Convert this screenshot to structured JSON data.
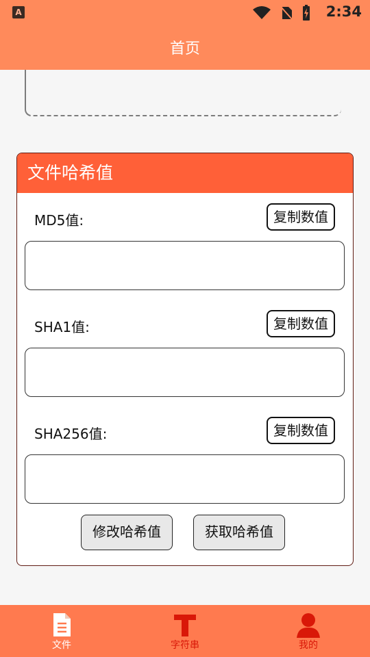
{
  "statusbar": {
    "app_icon_letter": "A",
    "time": "2:34",
    "icons": [
      "wifi-icon",
      "no-sim-icon",
      "battery-charging-icon"
    ]
  },
  "header": {
    "title": "首页"
  },
  "card": {
    "title": "文件哈希值",
    "md5": {
      "label": "MD5值:",
      "copy_label": "复制数值",
      "value": ""
    },
    "sha1": {
      "label": "SHA1值:",
      "copy_label": "复制数值",
      "value": ""
    },
    "sha256": {
      "label": "SHA256值:",
      "copy_label": "复制数值",
      "value": ""
    },
    "modify_label": "修改哈希值",
    "get_label": "获取哈希值"
  },
  "bottom_nav": {
    "items": [
      {
        "label": "文件",
        "icon": "file-icon",
        "color": "#ffffff"
      },
      {
        "label": "字符串",
        "icon": "text-t-icon",
        "color": "#d91808"
      },
      {
        "label": "我的",
        "icon": "user-icon",
        "color": "#d91808"
      }
    ]
  },
  "colors": {
    "appbar": "#ff8a5b",
    "card_header": "#ff6038",
    "bottom_nav": "#ff7a4f",
    "accent_red": "#d91808"
  }
}
